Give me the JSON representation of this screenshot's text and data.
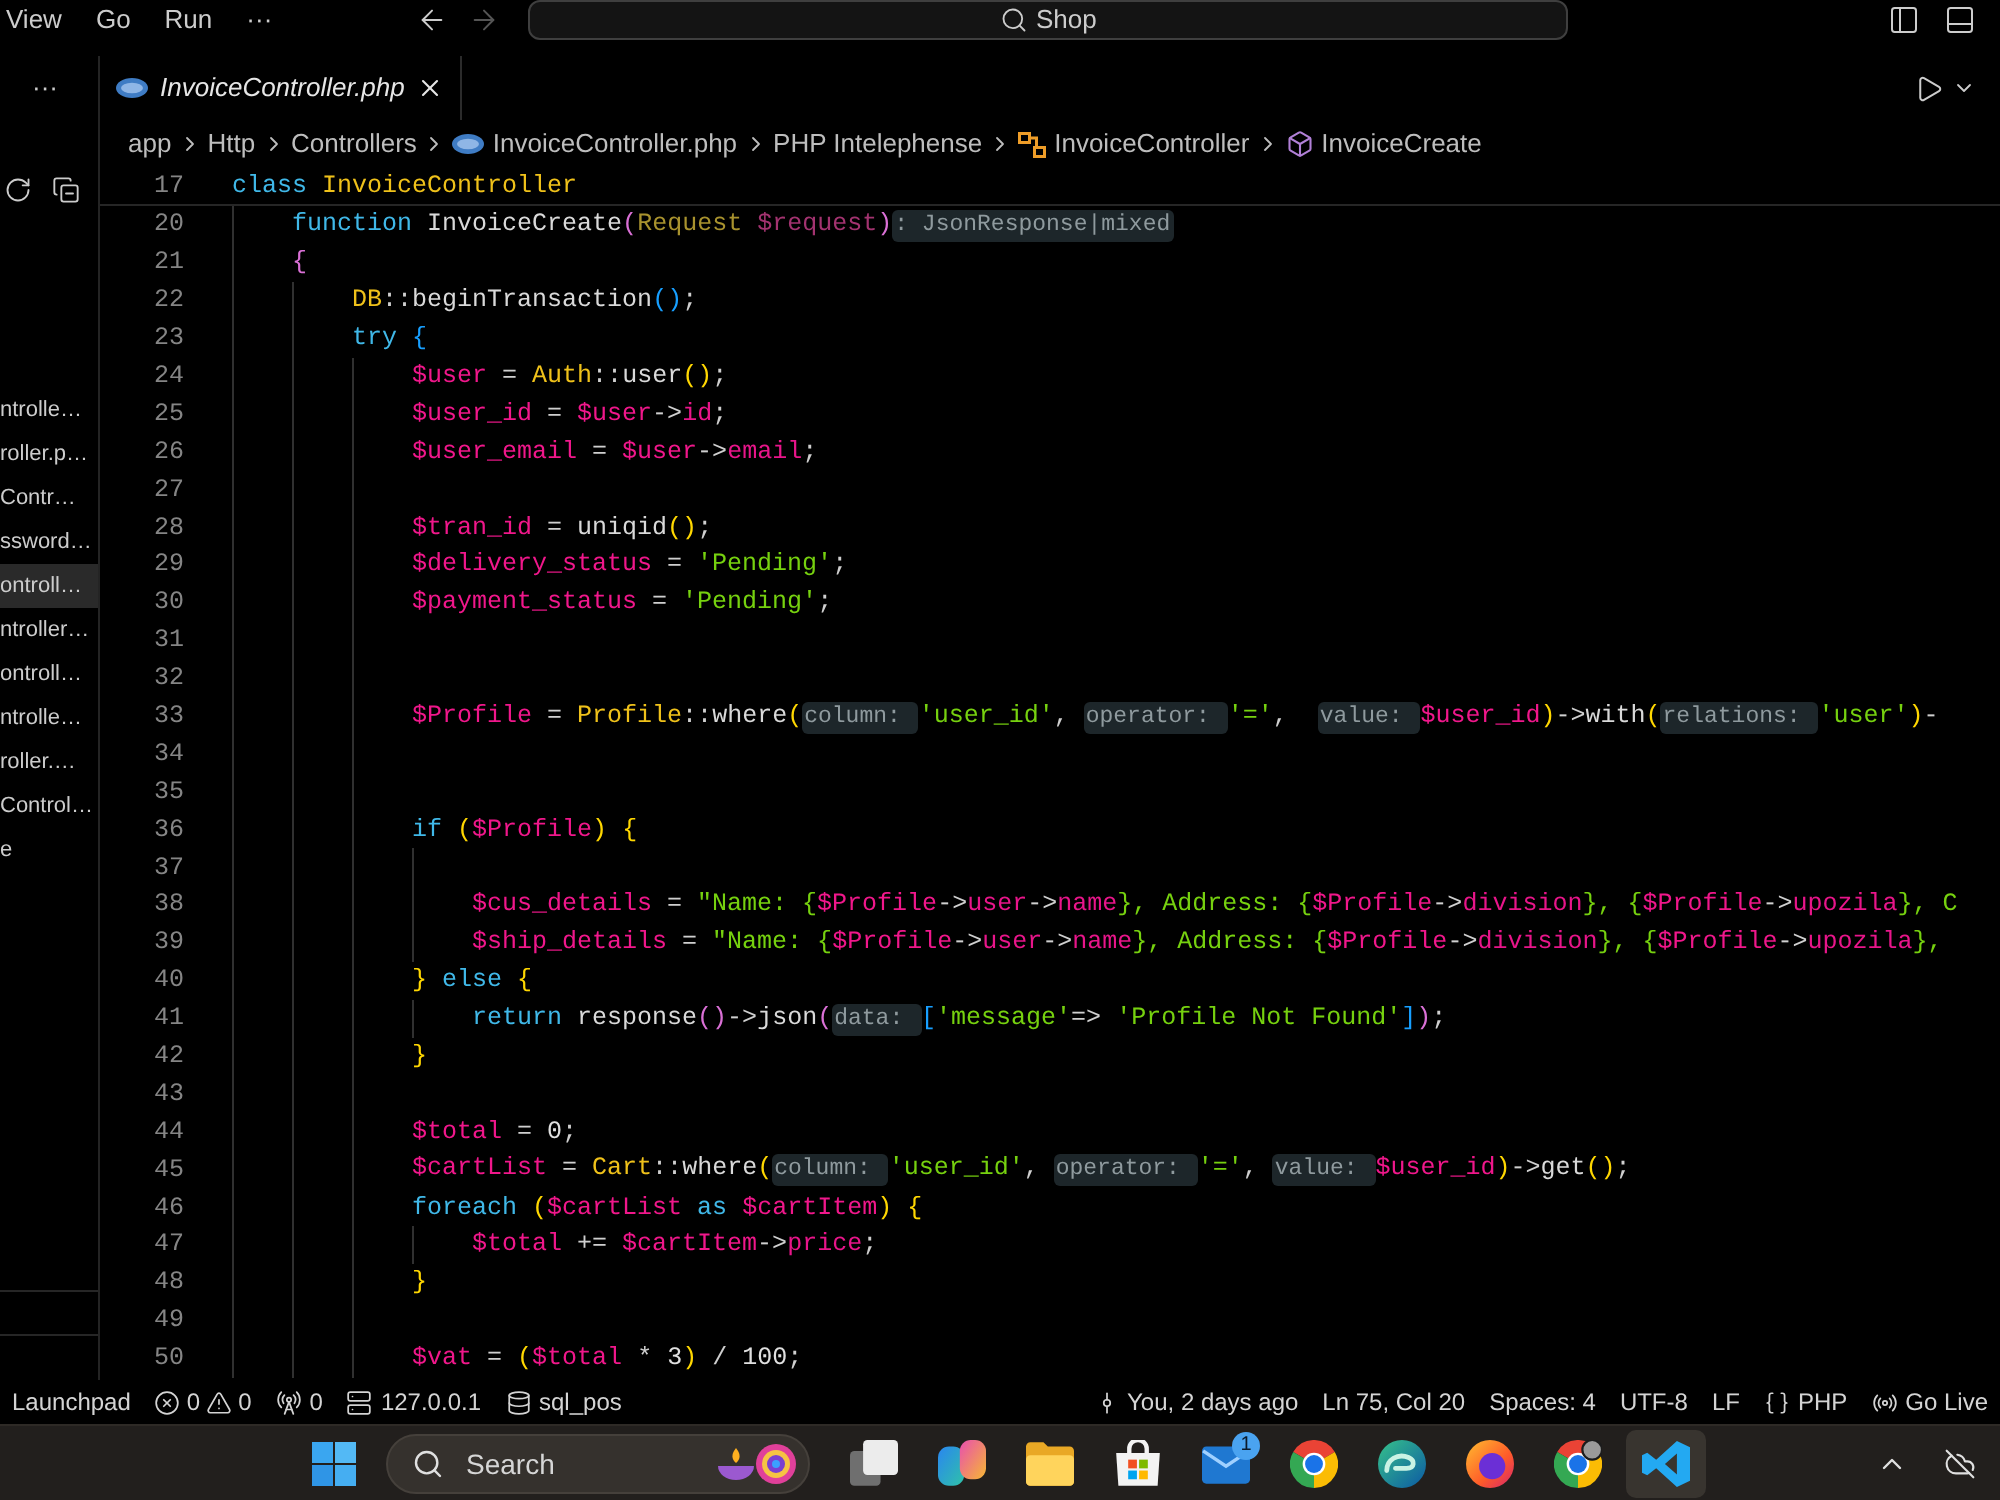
{
  "title_bar": {
    "menu": [
      {
        "label": "View"
      },
      {
        "label": "Go"
      },
      {
        "label": "Run"
      },
      {
        "label": "···"
      }
    ],
    "nav_buttons": [
      {
        "kind": "back",
        "disabled": false
      },
      {
        "kind": "forward",
        "disabled": true
      }
    ],
    "command_center": {
      "label": "Shop"
    }
  },
  "sidebar": {
    "more": "···",
    "items": [
      {
        "label": "ntrolle…",
        "selected": false
      },
      {
        "label": "roller.p…",
        "selected": false
      },
      {
        "label": "Contr…",
        "selected": false
      },
      {
        "label": "ssword…",
        "selected": false
      },
      {
        "label": "ontroll…",
        "selected": true
      },
      {
        "label": "ntroller…",
        "selected": false
      },
      {
        "label": "ontroll…",
        "selected": false
      },
      {
        "label": "ntrolle…",
        "selected": false
      },
      {
        "label": "roller.…",
        "selected": false
      },
      {
        "label": "Control…",
        "selected": false
      },
      {
        "label": "e",
        "selected": false
      }
    ]
  },
  "tabs": [
    {
      "label": "InvoiceController.php",
      "selected": true,
      "preview": true
    }
  ],
  "breadcrumbs": [
    {
      "label": "app",
      "kind": "folder"
    },
    {
      "label": "Http",
      "kind": "folder"
    },
    {
      "label": "Controllers",
      "kind": "folder"
    },
    {
      "label": "InvoiceController.php",
      "kind": "file"
    },
    {
      "label": "PHP Intelephense",
      "kind": "provider"
    },
    {
      "label": "InvoiceController",
      "kind": "class"
    },
    {
      "label": "InvoiceCreate",
      "kind": "method"
    }
  ],
  "editor": {
    "sticky_line": {
      "number": "17",
      "tokens": [
        {
          "text": "class ",
          "kind": "keyword"
        },
        {
          "text": "InvoiceController",
          "kind": "class"
        }
      ],
      "children": [
        {
          "number": "20",
          "tokens": [
            {
              "text": "function ",
              "kind": "keyword"
            },
            {
              "text": "InvoiceCreate",
              "kind": "function"
            },
            {
              "text": "(",
              "kind": "bracket",
              "color": "#da70d6"
            },
            {
              "text": "Request ",
              "kind": "type"
            },
            {
              "text": "$request",
              "kind": "param"
            },
            {
              "text": ")",
              "kind": "bracket",
              "color": "#da70d6"
            },
            {
              "text": ": JsonResponse|mixed",
              "kind": "hint"
            }
          ]
        },
        {
          "number": "21",
          "tokens": [
            {
              "text": "{",
              "kind": "bracket",
              "color": "#da70d6"
            }
          ],
          "children": [
            {
              "number": "22",
              "tokens": [
                {
                  "text": "DB",
                  "kind": "class"
                },
                {
                  "text": "::",
                  "kind": "operator"
                },
                {
                  "text": "beginTransaction",
                  "kind": "function"
                },
                {
                  "text": "()",
                  "kind": "bracket",
                  "color": "#179fff"
                },
                {
                  "text": ";",
                  "kind": "operator"
                }
              ]
            },
            {
              "number": "23",
              "tokens": [
                {
                  "text": "try ",
                  "kind": "keyword"
                },
                {
                  "text": "{",
                  "kind": "bracket",
                  "color": "#179fff"
                }
              ],
              "children": [
                {
                  "number": "24",
                  "tokens": [
                    {
                      "text": "$user",
                      "kind": "variable"
                    },
                    {
                      "text": " = ",
                      "kind": "operator"
                    },
                    {
                      "text": "Auth",
                      "kind": "class"
                    },
                    {
                      "text": "::",
                      "kind": "operator"
                    },
                    {
                      "text": "user",
                      "kind": "function"
                    },
                    {
                      "text": "()",
                      "kind": "bracket",
                      "color": "#ffd700"
                    },
                    {
                      "text": ";",
                      "kind": "operator"
                    }
                  ]
                },
                {
                  "number": "25",
                  "tokens": [
                    {
                      "text": "$user_id",
                      "kind": "variable"
                    },
                    {
                      "text": " = ",
                      "kind": "operator"
                    },
                    {
                      "text": "$user",
                      "kind": "variable"
                    },
                    {
                      "text": "->",
                      "kind": "operator"
                    },
                    {
                      "text": "id",
                      "kind": "property"
                    },
                    {
                      "text": ";",
                      "kind": "operator"
                    }
                  ]
                },
                {
                  "number": "26",
                  "tokens": [
                    {
                      "text": "$user_email",
                      "kind": "variable"
                    },
                    {
                      "text": " = ",
                      "kind": "operator"
                    },
                    {
                      "text": "$user",
                      "kind": "variable"
                    },
                    {
                      "text": "->",
                      "kind": "operator"
                    },
                    {
                      "text": "email",
                      "kind": "property"
                    },
                    {
                      "text": ";",
                      "kind": "operator"
                    }
                  ]
                },
                {
                  "number": "27"
                },
                {
                  "number": "28",
                  "tokens": [
                    {
                      "text": "$tran_id",
                      "kind": "variable"
                    },
                    {
                      "text": " = ",
                      "kind": "operator"
                    },
                    {
                      "text": "uniqid",
                      "kind": "function"
                    },
                    {
                      "text": "()",
                      "kind": "bracket",
                      "color": "#ffd700"
                    },
                    {
                      "text": ";",
                      "kind": "operator"
                    }
                  ]
                },
                {
                  "number": "29",
                  "tokens": [
                    {
                      "text": "$delivery_status",
                      "kind": "variable"
                    },
                    {
                      "text": " = ",
                      "kind": "operator"
                    },
                    {
                      "text": "'Pending'",
                      "kind": "string"
                    },
                    {
                      "text": ";",
                      "kind": "operator"
                    }
                  ]
                },
                {
                  "number": "30",
                  "tokens": [
                    {
                      "text": "$payment_status",
                      "kind": "variable"
                    },
                    {
                      "text": " = ",
                      "kind": "operator"
                    },
                    {
                      "text": "'Pending'",
                      "kind": "string"
                    },
                    {
                      "text": ";",
                      "kind": "operator"
                    }
                  ]
                },
                {
                  "number": "31"
                },
                {
                  "number": "32"
                },
                {
                  "number": "33",
                  "tokens": [
                    {
                      "text": "$Profile",
                      "kind": "variable"
                    },
                    {
                      "text": " = ",
                      "kind": "operator"
                    },
                    {
                      "text": "Profile",
                      "kind": "class"
                    },
                    {
                      "text": "::",
                      "kind": "operator"
                    },
                    {
                      "text": "where",
                      "kind": "function"
                    },
                    {
                      "text": "(",
                      "kind": "bracket",
                      "color": "#ffd700"
                    },
                    {
                      "text": "column: ",
                      "kind": "hint"
                    },
                    {
                      "text": "'user_id'",
                      "kind": "string"
                    },
                    {
                      "text": ", ",
                      "kind": "operator"
                    },
                    {
                      "text": "operator: ",
                      "kind": "hint"
                    },
                    {
                      "text": "'='",
                      "kind": "string"
                    },
                    {
                      "text": ",  ",
                      "kind": "operator"
                    },
                    {
                      "text": "value: ",
                      "kind": "hint"
                    },
                    {
                      "text": "$user_id",
                      "kind": "variable"
                    },
                    {
                      "text": ")",
                      "kind": "bracket",
                      "color": "#ffd700"
                    },
                    {
                      "text": "->",
                      "kind": "operator"
                    },
                    {
                      "text": "with",
                      "kind": "function"
                    },
                    {
                      "text": "(",
                      "kind": "bracket",
                      "color": "#ffd700"
                    },
                    {
                      "text": "relations: ",
                      "kind": "hint"
                    },
                    {
                      "text": "'user'",
                      "kind": "string"
                    },
                    {
                      "text": ")",
                      "kind": "bracket",
                      "color": "#ffd700"
                    },
                    {
                      "text": "-",
                      "kind": "operator"
                    }
                  ]
                },
                {
                  "number": "34"
                },
                {
                  "number": "35"
                },
                {
                  "number": "36",
                  "tokens": [
                    {
                      "text": "if ",
                      "kind": "keyword"
                    },
                    {
                      "text": "(",
                      "kind": "bracket",
                      "color": "#ffd700"
                    },
                    {
                      "text": "$Profile",
                      "kind": "variable"
                    },
                    {
                      "text": ")",
                      "kind": "bracket",
                      "color": "#ffd700"
                    },
                    {
                      "text": " {",
                      "kind": "bracket",
                      "color": "#ffd700"
                    }
                  ],
                  "children": [
                    {
                      "number": "37"
                    },
                    {
                      "number": "38",
                      "tokens": [
                        {
                          "text": "$cus_details",
                          "kind": "variable"
                        },
                        {
                          "text": " = ",
                          "kind": "operator"
                        },
                        {
                          "text": "\"Name: {",
                          "kind": "string"
                        },
                        {
                          "text": "$Profile",
                          "kind": "variable"
                        },
                        {
                          "text": "->",
                          "kind": "operator"
                        },
                        {
                          "text": "user",
                          "kind": "property"
                        },
                        {
                          "text": "->",
                          "kind": "operator"
                        },
                        {
                          "text": "name",
                          "kind": "property"
                        },
                        {
                          "text": "}, Address: {",
                          "kind": "string"
                        },
                        {
                          "text": "$Profile",
                          "kind": "variable"
                        },
                        {
                          "text": "->",
                          "kind": "operator"
                        },
                        {
                          "text": "division",
                          "kind": "property"
                        },
                        {
                          "text": "}, {",
                          "kind": "string"
                        },
                        {
                          "text": "$Profile",
                          "kind": "variable"
                        },
                        {
                          "text": "->",
                          "kind": "operator"
                        },
                        {
                          "text": "upozila",
                          "kind": "property"
                        },
                        {
                          "text": "}, C",
                          "kind": "string"
                        }
                      ]
                    },
                    {
                      "number": "39",
                      "tokens": [
                        {
                          "text": "$ship_details",
                          "kind": "variable"
                        },
                        {
                          "text": " = ",
                          "kind": "operator"
                        },
                        {
                          "text": "\"Name: {",
                          "kind": "string"
                        },
                        {
                          "text": "$Profile",
                          "kind": "variable"
                        },
                        {
                          "text": "->",
                          "kind": "operator"
                        },
                        {
                          "text": "user",
                          "kind": "property"
                        },
                        {
                          "text": "->",
                          "kind": "operator"
                        },
                        {
                          "text": "name",
                          "kind": "property"
                        },
                        {
                          "text": "}, Address: {",
                          "kind": "string"
                        },
                        {
                          "text": "$Profile",
                          "kind": "variable"
                        },
                        {
                          "text": "->",
                          "kind": "operator"
                        },
                        {
                          "text": "division",
                          "kind": "property"
                        },
                        {
                          "text": "}, {",
                          "kind": "string"
                        },
                        {
                          "text": "$Profile",
                          "kind": "variable"
                        },
                        {
                          "text": "->",
                          "kind": "operator"
                        },
                        {
                          "text": "upozila",
                          "kind": "property"
                        },
                        {
                          "text": "},",
                          "kind": "string"
                        }
                      ]
                    }
                  ]
                },
                {
                  "number": "40",
                  "tokens": [
                    {
                      "text": "}",
                      "kind": "bracket",
                      "color": "#ffd700"
                    },
                    {
                      "text": " else ",
                      "kind": "keyword"
                    },
                    {
                      "text": "{",
                      "kind": "bracket",
                      "color": "#ffd700"
                    }
                  ],
                  "children": [
                    {
                      "number": "41",
                      "tokens": [
                        {
                          "text": "return ",
                          "kind": "keyword"
                        },
                        {
                          "text": "response",
                          "kind": "function"
                        },
                        {
                          "text": "()",
                          "kind": "bracket",
                          "color": "#da70d6"
                        },
                        {
                          "text": "->",
                          "kind": "operator"
                        },
                        {
                          "text": "json",
                          "kind": "function"
                        },
                        {
                          "text": "(",
                          "kind": "bracket",
                          "color": "#da70d6"
                        },
                        {
                          "text": "data: ",
                          "kind": "hint"
                        },
                        {
                          "text": "[",
                          "kind": "bracket",
                          "color": "#179fff"
                        },
                        {
                          "text": "'message'",
                          "kind": "string"
                        },
                        {
                          "text": "=> ",
                          "kind": "operator"
                        },
                        {
                          "text": "'Profile Not Found'",
                          "kind": "string"
                        },
                        {
                          "text": "]",
                          "kind": "bracket",
                          "color": "#179fff"
                        },
                        {
                          "text": ")",
                          "kind": "bracket",
                          "color": "#da70d6"
                        },
                        {
                          "text": ";",
                          "kind": "operator"
                        }
                      ]
                    }
                  ]
                },
                {
                  "number": "42",
                  "tokens": [
                    {
                      "text": "}",
                      "kind": "bracket",
                      "color": "#ffd700"
                    }
                  ]
                },
                {
                  "number": "43"
                },
                {
                  "number": "44",
                  "tokens": [
                    {
                      "text": "$total",
                      "kind": "variable"
                    },
                    {
                      "text": " = ",
                      "kind": "operator"
                    },
                    {
                      "text": "0",
                      "kind": "number"
                    },
                    {
                      "text": ";",
                      "kind": "operator"
                    }
                  ]
                },
                {
                  "number": "45",
                  "tokens": [
                    {
                      "text": "$cartList",
                      "kind": "variable"
                    },
                    {
                      "text": " = ",
                      "kind": "operator"
                    },
                    {
                      "text": "Cart",
                      "kind": "class"
                    },
                    {
                      "text": "::",
                      "kind": "operator"
                    },
                    {
                      "text": "where",
                      "kind": "function"
                    },
                    {
                      "text": "(",
                      "kind": "bracket",
                      "color": "#ffd700"
                    },
                    {
                      "text": "column: ",
                      "kind": "hint"
                    },
                    {
                      "text": "'user_id'",
                      "kind": "string"
                    },
                    {
                      "text": ", ",
                      "kind": "operator"
                    },
                    {
                      "text": "operator: ",
                      "kind": "hint"
                    },
                    {
                      "text": "'='",
                      "kind": "string"
                    },
                    {
                      "text": ", ",
                      "kind": "operator"
                    },
                    {
                      "text": "value: ",
                      "kind": "hint"
                    },
                    {
                      "text": "$user_id",
                      "kind": "variable"
                    },
                    {
                      "text": ")",
                      "kind": "bracket",
                      "color": "#ffd700"
                    },
                    {
                      "text": "->",
                      "kind": "operator"
                    },
                    {
                      "text": "get",
                      "kind": "function"
                    },
                    {
                      "text": "()",
                      "kind": "bracket",
                      "color": "#ffd700"
                    },
                    {
                      "text": ";",
                      "kind": "operator"
                    }
                  ]
                },
                {
                  "number": "46",
                  "tokens": [
                    {
                      "text": "foreach ",
                      "kind": "keyword"
                    },
                    {
                      "text": "(",
                      "kind": "bracket",
                      "color": "#ffd700"
                    },
                    {
                      "text": "$cartList",
                      "kind": "variable"
                    },
                    {
                      "text": " as ",
                      "kind": "keyword"
                    },
                    {
                      "text": "$cartItem",
                      "kind": "variable"
                    },
                    {
                      "text": ")",
                      "kind": "bracket",
                      "color": "#ffd700"
                    },
                    {
                      "text": " {",
                      "kind": "bracket",
                      "color": "#ffd700"
                    }
                  ],
                  "children": [
                    {
                      "number": "47",
                      "tokens": [
                        {
                          "text": "$total",
                          "kind": "variable"
                        },
                        {
                          "text": " += ",
                          "kind": "operator"
                        },
                        {
                          "text": "$cartItem",
                          "kind": "variable"
                        },
                        {
                          "text": "->",
                          "kind": "operator"
                        },
                        {
                          "text": "price",
                          "kind": "property"
                        },
                        {
                          "text": ";",
                          "kind": "operator"
                        }
                      ]
                    }
                  ]
                },
                {
                  "number": "48",
                  "tokens": [
                    {
                      "text": "}",
                      "kind": "bracket",
                      "color": "#ffd700"
                    }
                  ]
                },
                {
                  "number": "49"
                },
                {
                  "number": "50",
                  "tokens": [
                    {
                      "text": "$vat",
                      "kind": "variable"
                    },
                    {
                      "text": " = ",
                      "kind": "operator"
                    },
                    {
                      "text": "(",
                      "kind": "bracket",
                      "color": "#ffd700"
                    },
                    {
                      "text": "$total",
                      "kind": "variable"
                    },
                    {
                      "text": " * ",
                      "kind": "operator"
                    },
                    {
                      "text": "3",
                      "kind": "number"
                    },
                    {
                      "text": ")",
                      "kind": "bracket",
                      "color": "#ffd700"
                    },
                    {
                      "text": " / ",
                      "kind": "operator"
                    },
                    {
                      "text": "100",
                      "kind": "number"
                    },
                    {
                      "text": ";",
                      "kind": "operator"
                    }
                  ]
                }
              ]
            }
          ]
        }
      ]
    }
  },
  "status_bar": {
    "left": [
      {
        "kind": "text",
        "text": "Launchpad"
      },
      {
        "kind": "problems",
        "errors": "0",
        "warnings": "0"
      },
      {
        "kind": "ports",
        "text": "0"
      },
      {
        "kind": "server",
        "text": "127.0.0.1"
      },
      {
        "kind": "database",
        "text": "sql_pos"
      }
    ],
    "right": [
      {
        "kind": "blame",
        "text": "You, 2 days ago"
      },
      {
        "kind": "text",
        "text": "Ln 75, Col 20"
      },
      {
        "kind": "text",
        "text": "Spaces: 4"
      },
      {
        "kind": "text",
        "text": "UTF-8"
      },
      {
        "kind": "text",
        "text": "LF"
      },
      {
        "kind": "language",
        "text": "PHP"
      },
      {
        "kind": "live",
        "text": "Go Live"
      }
    ]
  },
  "taskbar": {
    "search": {
      "placeholder": "Search"
    },
    "apps": [
      {
        "kind": "taskview",
        "selected": false
      },
      {
        "kind": "assistant",
        "selected": false
      },
      {
        "kind": "files",
        "selected": false
      },
      {
        "kind": "store",
        "selected": false
      },
      {
        "kind": "mail",
        "selected": false,
        "badge": "1"
      },
      {
        "kind": "chrome",
        "selected": false
      },
      {
        "kind": "edge",
        "selected": false
      },
      {
        "kind": "firefox",
        "selected": false
      },
      {
        "kind": "chromeprofile",
        "selected": false
      },
      {
        "kind": "vscode",
        "selected": true
      }
    ]
  }
}
